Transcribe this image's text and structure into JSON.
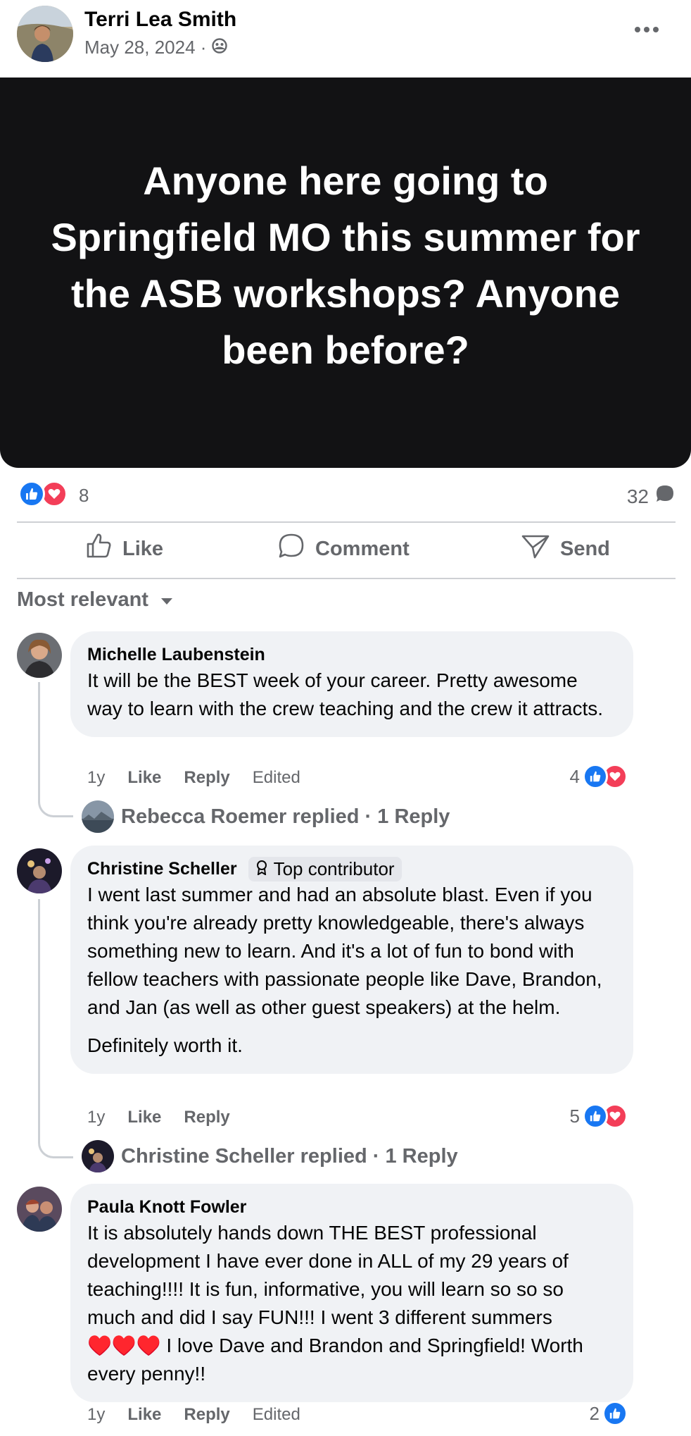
{
  "post": {
    "author": "Terri Lea Smith",
    "date": "May 28, 2024 ·",
    "audience_icon": "group-icon",
    "text": "Anyone here going to Springfield MO this summer for the ASB workshops? Anyone been before?",
    "reaction_count": "8",
    "comment_count": "32"
  },
  "actions": {
    "like": "Like",
    "comment": "Comment",
    "send": "Send"
  },
  "sort": {
    "label": "Most relevant"
  },
  "comments": [
    {
      "author": "Michelle Laubenstein",
      "text": "It will be the BEST week of your career. Pretty awesome way to learn with the crew teaching and the crew it attracts.",
      "time": "1y",
      "like": "Like",
      "reply": "Reply",
      "edited": "Edited",
      "reaction_count": "4",
      "reply_summary": "Rebecca Roemer replied · 1 Reply"
    },
    {
      "author": "Christine Scheller",
      "badge": "Top contributor",
      "text": "I went last summer and had an absolute blast. Even if you think you're already pretty knowledgeable, there's always something new to learn. And it's a lot of fun to bond with fellow teachers with passionate people like Dave, Brandon, and Jan (as well as other guest speakers) at the helm.",
      "text2": "Definitely worth it.",
      "time": "1y",
      "like": "Like",
      "reply": "Reply",
      "reaction_count": "5",
      "reply_summary": "Christine Scheller replied · 1 Reply"
    },
    {
      "author": "Paula Knott Fowler",
      "text": "It is absolutely hands down THE BEST professional development I have ever done in ALL of my 29 years of teaching!!!! It is fun, informative, you will learn so so so much and did I say FUN!!! I went 3 different summers ♥️♥️♥️ I love Dave and Brandon and Springfield! Worth every penny!!",
      "time": "1y",
      "like": "Like",
      "reply": "Reply",
      "edited": "Edited",
      "reaction_count": "2"
    }
  ],
  "colors": {
    "like_blue": "#1877f2",
    "love_red": "#f33e58",
    "bubble": "#f0f2f5",
    "meta_gray": "#65676b",
    "post_bg": "#121214"
  }
}
